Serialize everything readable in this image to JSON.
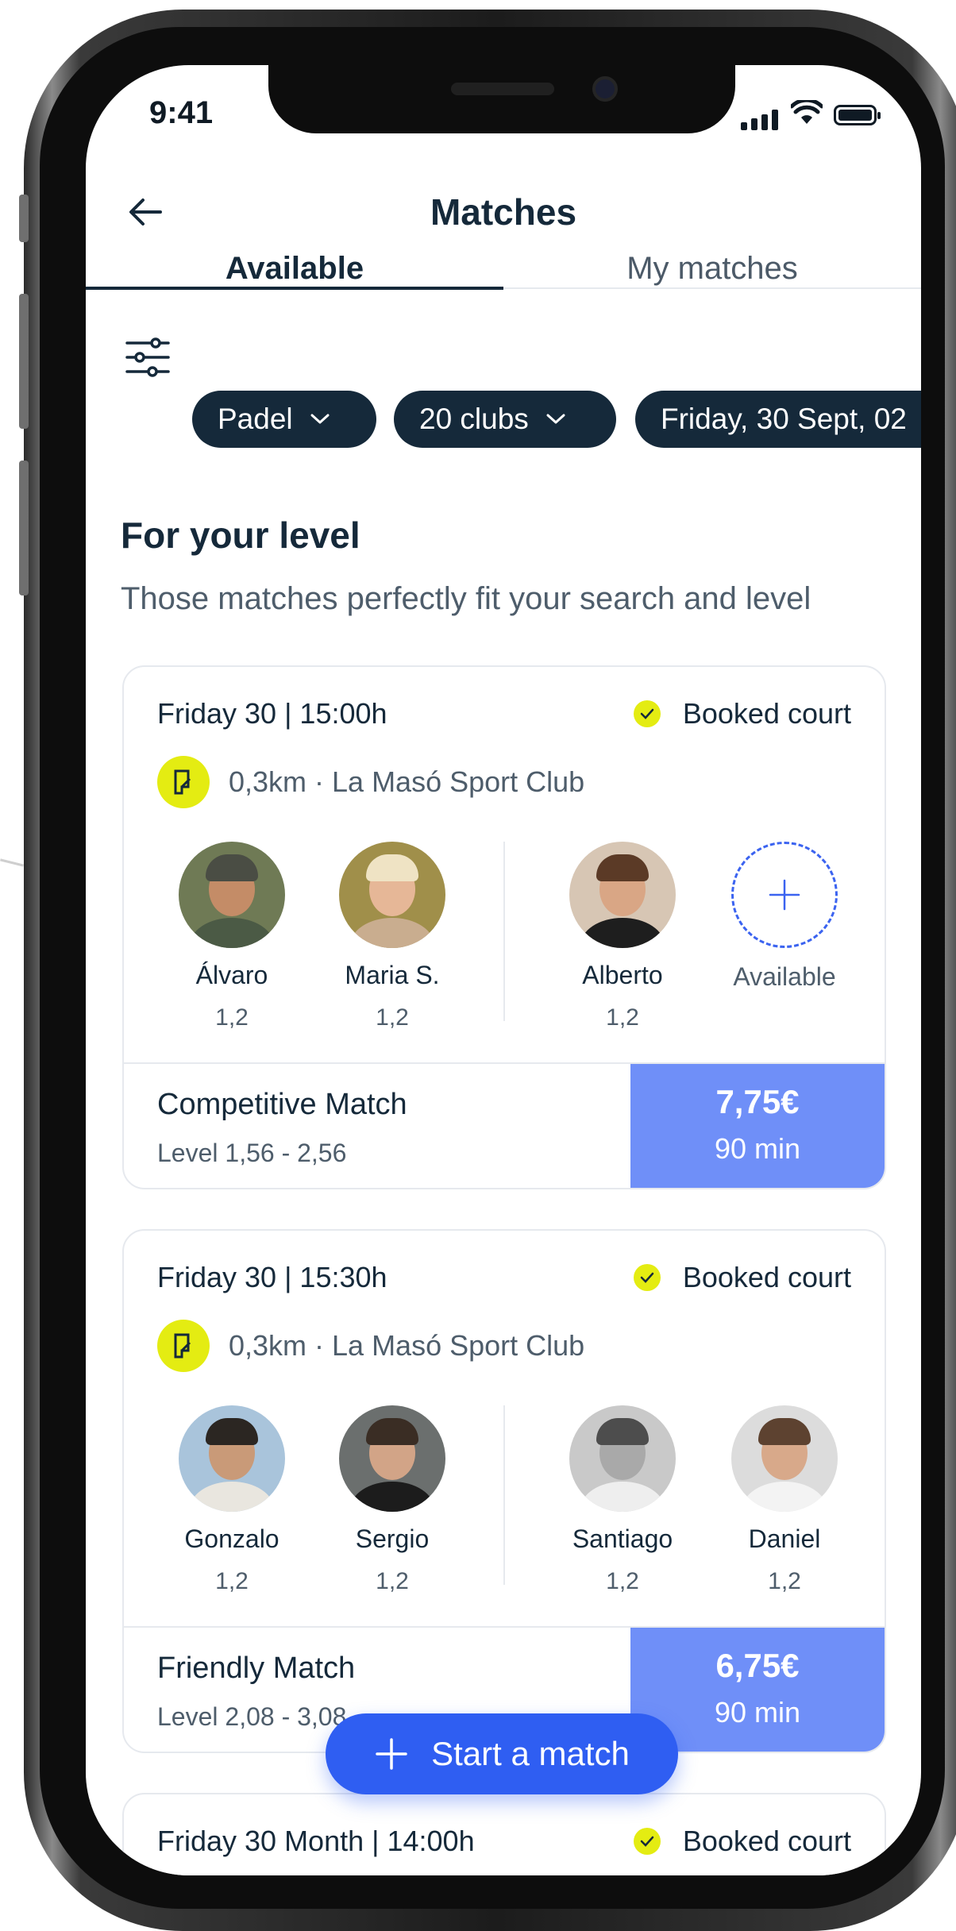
{
  "status_bar": {
    "time": "9:41"
  },
  "header": {
    "title": "Matches"
  },
  "tabs": [
    {
      "label": "Available",
      "active": true
    },
    {
      "label": "My matches",
      "active": false
    }
  ],
  "filters": {
    "sport": "Padel",
    "clubs": "20 clubs",
    "date": "Friday, 30 Sept, 02"
  },
  "section": {
    "title": "For your level",
    "subtitle": "Those matches perfectly fit  your search and level"
  },
  "matches": [
    {
      "when": "Friday 30 | 15:00h",
      "booked_label": "Booked court",
      "club": "0,3km · La Masó Sport Club",
      "players": [
        {
          "name": "Álvaro",
          "level": "1,2"
        },
        {
          "name": "Maria S.",
          "level": "1,2"
        },
        {
          "name": "Alberto",
          "level": "1,2"
        },
        {
          "name": "Available"
        }
      ],
      "type": "Competitive Match",
      "level_range": "Level  1,56 - 2,56",
      "price": "7,75€",
      "duration": "90 min"
    },
    {
      "when": "Friday 30 | 15:30h",
      "booked_label": "Booked court",
      "club": "0,3km · La Masó Sport Club",
      "players": [
        {
          "name": "Gonzalo",
          "level": "1,2"
        },
        {
          "name": "Sergio",
          "level": "1,2"
        },
        {
          "name": "Santiago",
          "level": "1,2"
        },
        {
          "name": "Daniel",
          "level": "1,2"
        }
      ],
      "type": "Friendly Match",
      "level_range": "Level  2,08 - 3,08",
      "price": "6,75€",
      "duration": "90 min"
    },
    {
      "when": "Friday 30 Month | 14:00h",
      "booked_label": "Booked court"
    }
  ],
  "fab": {
    "label": "Start a match"
  },
  "colors": {
    "primary_dark": "#15293a",
    "accent_blue": "#2f5ef2",
    "price_blue": "#6f8ff8",
    "lime": "#e4ec12"
  }
}
